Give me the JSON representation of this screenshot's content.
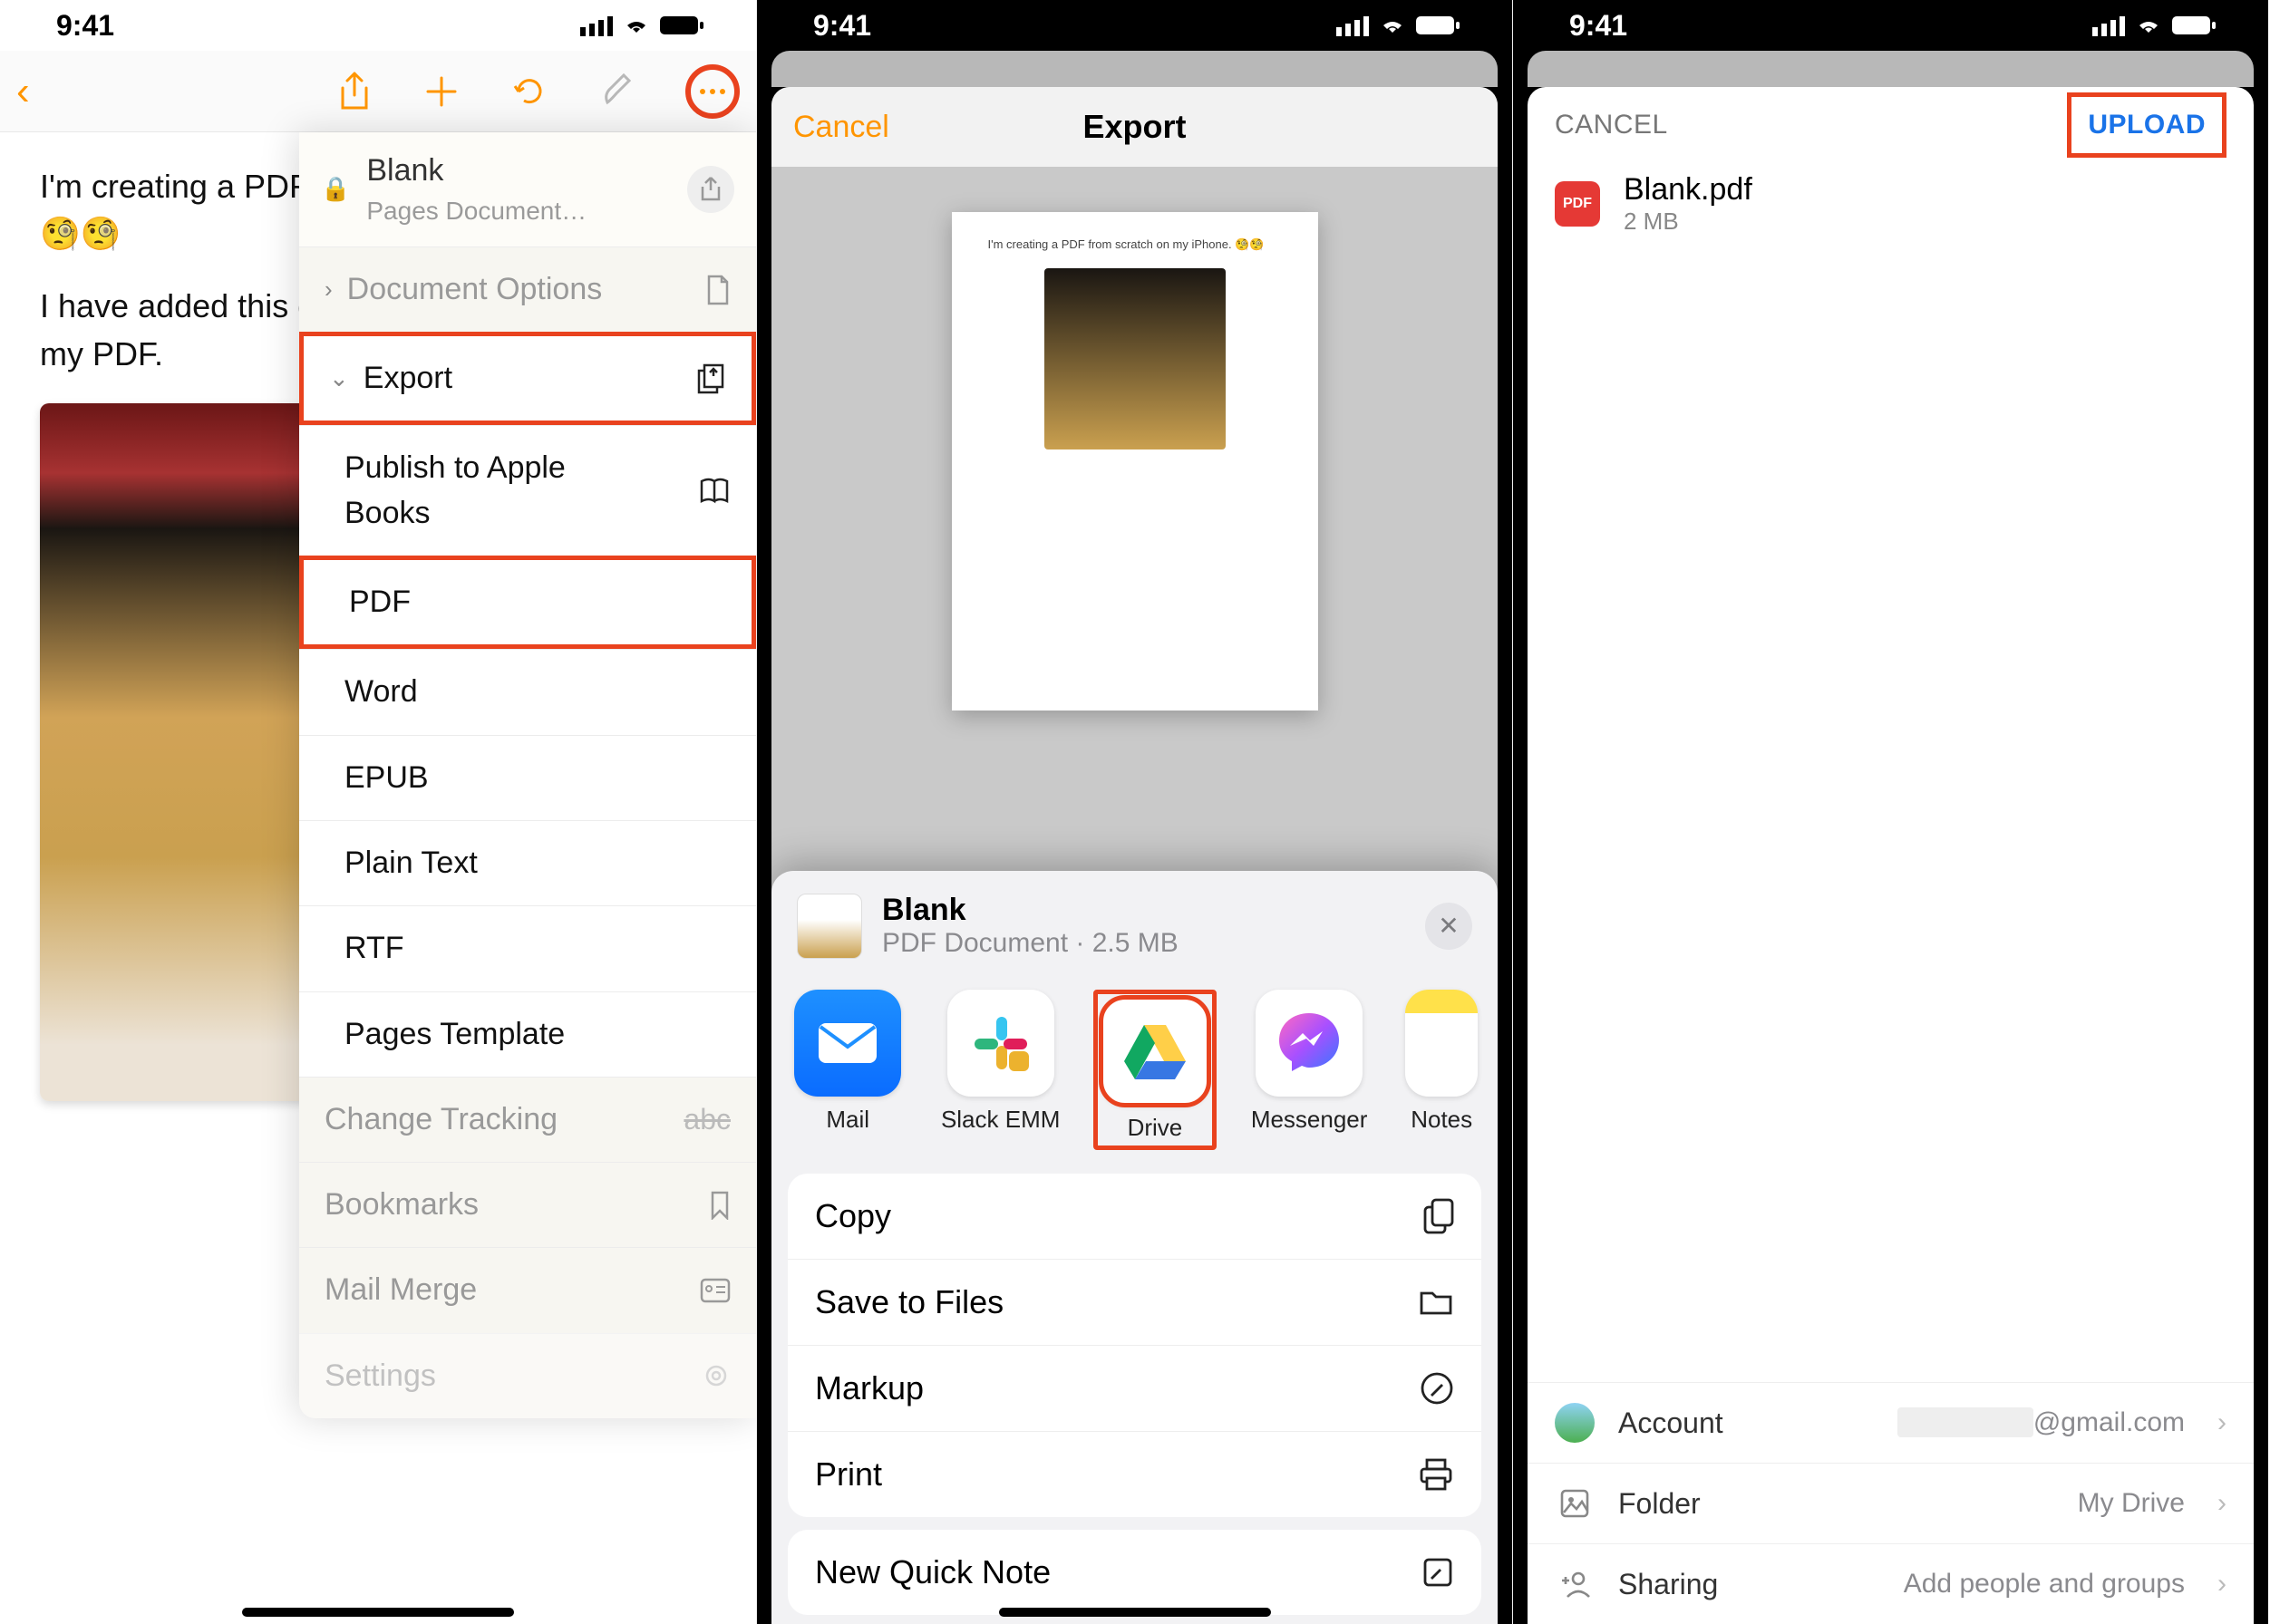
{
  "status": {
    "time": "9:41"
  },
  "phone1": {
    "body": {
      "line1": "I'm creating a PDF from scratch on my iPhone. 🧐🧐",
      "line2": "I have added this great image of noodles to my PDF."
    },
    "dropdown": {
      "file_title": "Blank",
      "file_sub": "Pages Document…",
      "doc_options": "Document Options",
      "export": "Export",
      "publish": "Publish to Apple Books",
      "pdf": "PDF",
      "word": "Word",
      "epub": "EPUB",
      "plain": "Plain Text",
      "rtf": "RTF",
      "pages_tpl": "Pages Template",
      "tracking": "Change Tracking",
      "bookmarks": "Bookmarks",
      "mailmerge": "Mail Merge",
      "settings": "Settings"
    }
  },
  "phone2": {
    "header": {
      "cancel": "Cancel",
      "title": "Export"
    },
    "preview_text": "I'm creating a PDF from scratch on my iPhone. 🧐🧐",
    "sheet": {
      "title": "Blank",
      "sub": "PDF Document · 2.5 MB",
      "apps": {
        "mail": "Mail",
        "slack": "Slack EMM",
        "drive": "Drive",
        "messenger": "Messenger",
        "notes": "Notes"
      },
      "actions": {
        "copy": "Copy",
        "save": "Save to Files",
        "markup": "Markup",
        "print": "Print",
        "quicknote": "New Quick Note"
      }
    }
  },
  "phone3": {
    "header": {
      "cancel": "CANCEL",
      "upload": "UPLOAD"
    },
    "file": {
      "name": "Blank.pdf",
      "size": "2 MB",
      "badge": "PDF"
    },
    "rows": {
      "account_label": "Account",
      "account_value": "@gmail.com",
      "folder_label": "Folder",
      "folder_value": "My Drive",
      "sharing_label": "Sharing",
      "sharing_value": "Add people and groups"
    }
  }
}
